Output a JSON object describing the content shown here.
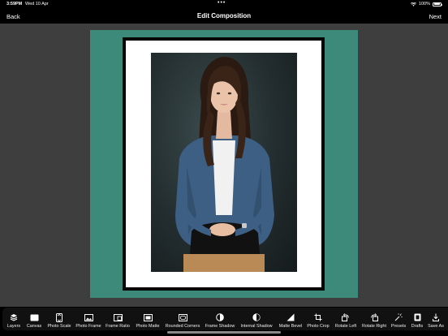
{
  "status_bar": {
    "time": "3:59PM",
    "date": "Wed 10 Apr",
    "dots": "•••",
    "battery": "100%"
  },
  "nav": {
    "back_label": "Back",
    "title": "Edit Composition",
    "next_label": "Next"
  },
  "canvas": {
    "background_color": "#3e8a7a",
    "frame_color": "#050505",
    "matte_color": "#ffffff"
  },
  "toolbar": {
    "items": [
      {
        "label": "Layers",
        "icon": "layers-icon"
      },
      {
        "label": "Canvas",
        "icon": "canvas-icon"
      },
      {
        "label": "Photo Scale",
        "icon": "photo-scale-icon"
      },
      {
        "label": "Photo Frame",
        "icon": "photo-frame-icon"
      },
      {
        "label": "Frame Ratio",
        "icon": "frame-ratio-icon"
      },
      {
        "label": "Photo Matte",
        "icon": "photo-matte-icon"
      },
      {
        "label": "Rounded Corners",
        "icon": "rounded-corners-icon"
      },
      {
        "label": "Frame Shadow",
        "icon": "frame-shadow-icon"
      },
      {
        "label": "Internal Shadow",
        "icon": "internal-shadow-icon"
      },
      {
        "label": "Matte Bevel",
        "icon": "matte-bevel-icon"
      },
      {
        "label": "Photo Crop",
        "icon": "photo-crop-icon"
      },
      {
        "label": "Rotate Left",
        "icon": "rotate-left-icon"
      },
      {
        "label": "Rotate Right",
        "icon": "rotate-right-icon"
      },
      {
        "label": "Presets",
        "icon": "presets-icon"
      },
      {
        "label": "Drafts",
        "icon": "drafts-icon"
      },
      {
        "label": "Save As",
        "icon": "save-as-icon"
      }
    ]
  }
}
